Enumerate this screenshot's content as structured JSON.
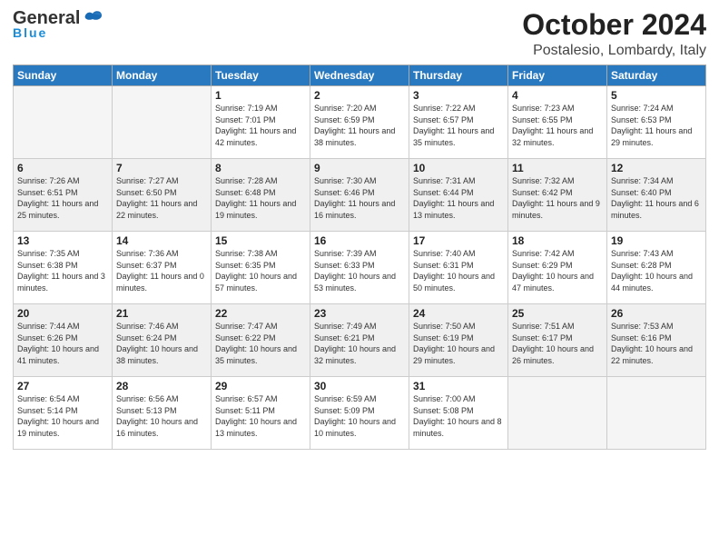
{
  "header": {
    "logo_general": "General",
    "logo_blue": "Blue",
    "month_title": "October 2024",
    "location": "Postalesio, Lombardy, Italy"
  },
  "days_of_week": [
    "Sunday",
    "Monday",
    "Tuesday",
    "Wednesday",
    "Thursday",
    "Friday",
    "Saturday"
  ],
  "weeks": [
    [
      {
        "day": "",
        "empty": true
      },
      {
        "day": "",
        "empty": true
      },
      {
        "day": "1",
        "sunrise": "Sunrise: 7:19 AM",
        "sunset": "Sunset: 7:01 PM",
        "daylight": "Daylight: 11 hours and 42 minutes."
      },
      {
        "day": "2",
        "sunrise": "Sunrise: 7:20 AM",
        "sunset": "Sunset: 6:59 PM",
        "daylight": "Daylight: 11 hours and 38 minutes."
      },
      {
        "day": "3",
        "sunrise": "Sunrise: 7:22 AM",
        "sunset": "Sunset: 6:57 PM",
        "daylight": "Daylight: 11 hours and 35 minutes."
      },
      {
        "day": "4",
        "sunrise": "Sunrise: 7:23 AM",
        "sunset": "Sunset: 6:55 PM",
        "daylight": "Daylight: 11 hours and 32 minutes."
      },
      {
        "day": "5",
        "sunrise": "Sunrise: 7:24 AM",
        "sunset": "Sunset: 6:53 PM",
        "daylight": "Daylight: 11 hours and 29 minutes."
      }
    ],
    [
      {
        "day": "6",
        "sunrise": "Sunrise: 7:26 AM",
        "sunset": "Sunset: 6:51 PM",
        "daylight": "Daylight: 11 hours and 25 minutes."
      },
      {
        "day": "7",
        "sunrise": "Sunrise: 7:27 AM",
        "sunset": "Sunset: 6:50 PM",
        "daylight": "Daylight: 11 hours and 22 minutes."
      },
      {
        "day": "8",
        "sunrise": "Sunrise: 7:28 AM",
        "sunset": "Sunset: 6:48 PM",
        "daylight": "Daylight: 11 hours and 19 minutes."
      },
      {
        "day": "9",
        "sunrise": "Sunrise: 7:30 AM",
        "sunset": "Sunset: 6:46 PM",
        "daylight": "Daylight: 11 hours and 16 minutes."
      },
      {
        "day": "10",
        "sunrise": "Sunrise: 7:31 AM",
        "sunset": "Sunset: 6:44 PM",
        "daylight": "Daylight: 11 hours and 13 minutes."
      },
      {
        "day": "11",
        "sunrise": "Sunrise: 7:32 AM",
        "sunset": "Sunset: 6:42 PM",
        "daylight": "Daylight: 11 hours and 9 minutes."
      },
      {
        "day": "12",
        "sunrise": "Sunrise: 7:34 AM",
        "sunset": "Sunset: 6:40 PM",
        "daylight": "Daylight: 11 hours and 6 minutes."
      }
    ],
    [
      {
        "day": "13",
        "sunrise": "Sunrise: 7:35 AM",
        "sunset": "Sunset: 6:38 PM",
        "daylight": "Daylight: 11 hours and 3 minutes."
      },
      {
        "day": "14",
        "sunrise": "Sunrise: 7:36 AM",
        "sunset": "Sunset: 6:37 PM",
        "daylight": "Daylight: 11 hours and 0 minutes."
      },
      {
        "day": "15",
        "sunrise": "Sunrise: 7:38 AM",
        "sunset": "Sunset: 6:35 PM",
        "daylight": "Daylight: 10 hours and 57 minutes."
      },
      {
        "day": "16",
        "sunrise": "Sunrise: 7:39 AM",
        "sunset": "Sunset: 6:33 PM",
        "daylight": "Daylight: 10 hours and 53 minutes."
      },
      {
        "day": "17",
        "sunrise": "Sunrise: 7:40 AM",
        "sunset": "Sunset: 6:31 PM",
        "daylight": "Daylight: 10 hours and 50 minutes."
      },
      {
        "day": "18",
        "sunrise": "Sunrise: 7:42 AM",
        "sunset": "Sunset: 6:29 PM",
        "daylight": "Daylight: 10 hours and 47 minutes."
      },
      {
        "day": "19",
        "sunrise": "Sunrise: 7:43 AM",
        "sunset": "Sunset: 6:28 PM",
        "daylight": "Daylight: 10 hours and 44 minutes."
      }
    ],
    [
      {
        "day": "20",
        "sunrise": "Sunrise: 7:44 AM",
        "sunset": "Sunset: 6:26 PM",
        "daylight": "Daylight: 10 hours and 41 minutes."
      },
      {
        "day": "21",
        "sunrise": "Sunrise: 7:46 AM",
        "sunset": "Sunset: 6:24 PM",
        "daylight": "Daylight: 10 hours and 38 minutes."
      },
      {
        "day": "22",
        "sunrise": "Sunrise: 7:47 AM",
        "sunset": "Sunset: 6:22 PM",
        "daylight": "Daylight: 10 hours and 35 minutes."
      },
      {
        "day": "23",
        "sunrise": "Sunrise: 7:49 AM",
        "sunset": "Sunset: 6:21 PM",
        "daylight": "Daylight: 10 hours and 32 minutes."
      },
      {
        "day": "24",
        "sunrise": "Sunrise: 7:50 AM",
        "sunset": "Sunset: 6:19 PM",
        "daylight": "Daylight: 10 hours and 29 minutes."
      },
      {
        "day": "25",
        "sunrise": "Sunrise: 7:51 AM",
        "sunset": "Sunset: 6:17 PM",
        "daylight": "Daylight: 10 hours and 26 minutes."
      },
      {
        "day": "26",
        "sunrise": "Sunrise: 7:53 AM",
        "sunset": "Sunset: 6:16 PM",
        "daylight": "Daylight: 10 hours and 22 minutes."
      }
    ],
    [
      {
        "day": "27",
        "sunrise": "Sunrise: 6:54 AM",
        "sunset": "Sunset: 5:14 PM",
        "daylight": "Daylight: 10 hours and 19 minutes."
      },
      {
        "day": "28",
        "sunrise": "Sunrise: 6:56 AM",
        "sunset": "Sunset: 5:13 PM",
        "daylight": "Daylight: 10 hours and 16 minutes."
      },
      {
        "day": "29",
        "sunrise": "Sunrise: 6:57 AM",
        "sunset": "Sunset: 5:11 PM",
        "daylight": "Daylight: 10 hours and 13 minutes."
      },
      {
        "day": "30",
        "sunrise": "Sunrise: 6:59 AM",
        "sunset": "Sunset: 5:09 PM",
        "daylight": "Daylight: 10 hours and 10 minutes."
      },
      {
        "day": "31",
        "sunrise": "Sunrise: 7:00 AM",
        "sunset": "Sunset: 5:08 PM",
        "daylight": "Daylight: 10 hours and 8 minutes."
      },
      {
        "day": "",
        "empty": true
      },
      {
        "day": "",
        "empty": true
      }
    ]
  ]
}
